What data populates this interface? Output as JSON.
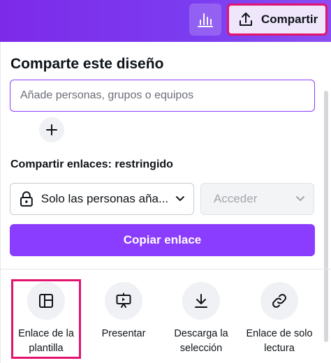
{
  "header": {
    "share_label": "Compartir",
    "icons": [
      "bar-chart-icon",
      "upload-icon"
    ]
  },
  "panel": {
    "title": "Comparte este diseño",
    "people_placeholder": "Añade personas, grupos o equipos",
    "links_label": "Compartir enlaces: restringido",
    "access_value": "Solo las personas aña...",
    "role_value": "Acceder",
    "copy_button": "Copiar enlace"
  },
  "options": [
    {
      "label_line1": "Enlace de la",
      "label_line2": "plantilla",
      "icon": "template-icon"
    },
    {
      "label_line1": "Presentar",
      "label_line2": "",
      "icon": "present-icon"
    },
    {
      "label_line1": "Descarga la",
      "label_line2": "selección",
      "icon": "download-icon"
    },
    {
      "label_line1": "Enlace de solo",
      "label_line2": "lectura",
      "icon": "link-icon"
    }
  ],
  "colors": {
    "accent": "#8b3dff",
    "highlight": "#e2146f",
    "topbar": "#7d2ae8"
  }
}
